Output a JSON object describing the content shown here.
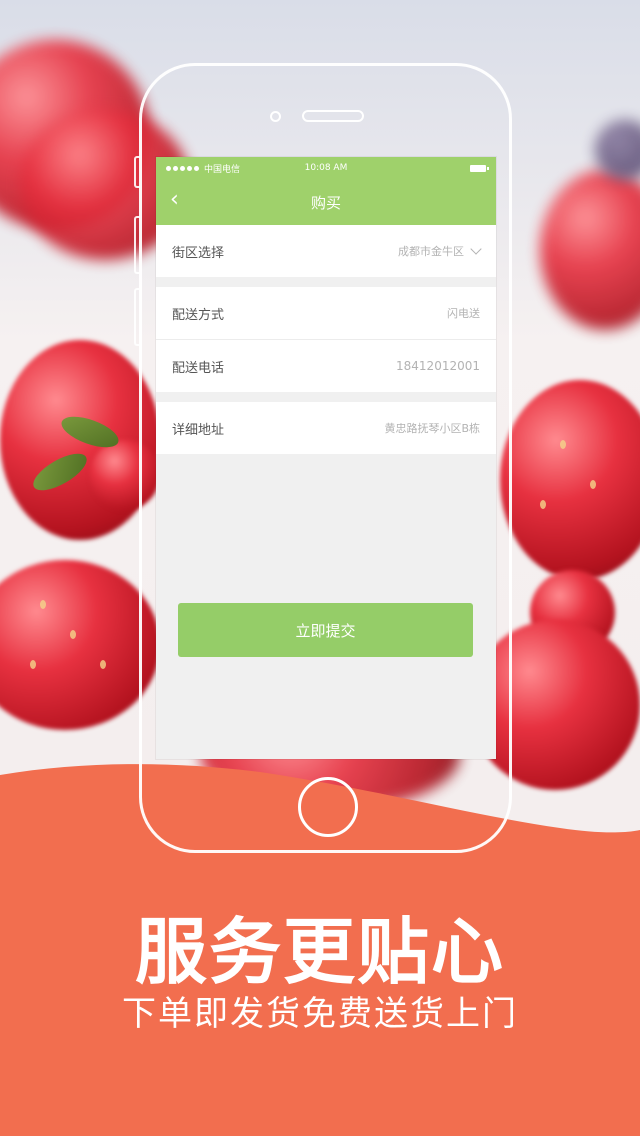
{
  "status_bar": {
    "carrier": "中国电信",
    "time": "10:08 AM"
  },
  "nav": {
    "title": "购买"
  },
  "form": {
    "district": {
      "label": "街区选择",
      "value": "成都市金牛区"
    },
    "delivery_method": {
      "label": "配送方式",
      "value": "闪电送"
    },
    "delivery_phone": {
      "label": "配送电话",
      "value": "18412012001"
    },
    "address": {
      "label": "详细地址",
      "value": "黄忠路抚琴小区B栋"
    }
  },
  "submit_label": "立即提交",
  "banner": {
    "headline": "服务更贴心",
    "subline": "下单即发货免费送货上门",
    "color": "#f26e4f"
  },
  "colors": {
    "accent": "#9fd16b",
    "button": "#95cd68"
  }
}
